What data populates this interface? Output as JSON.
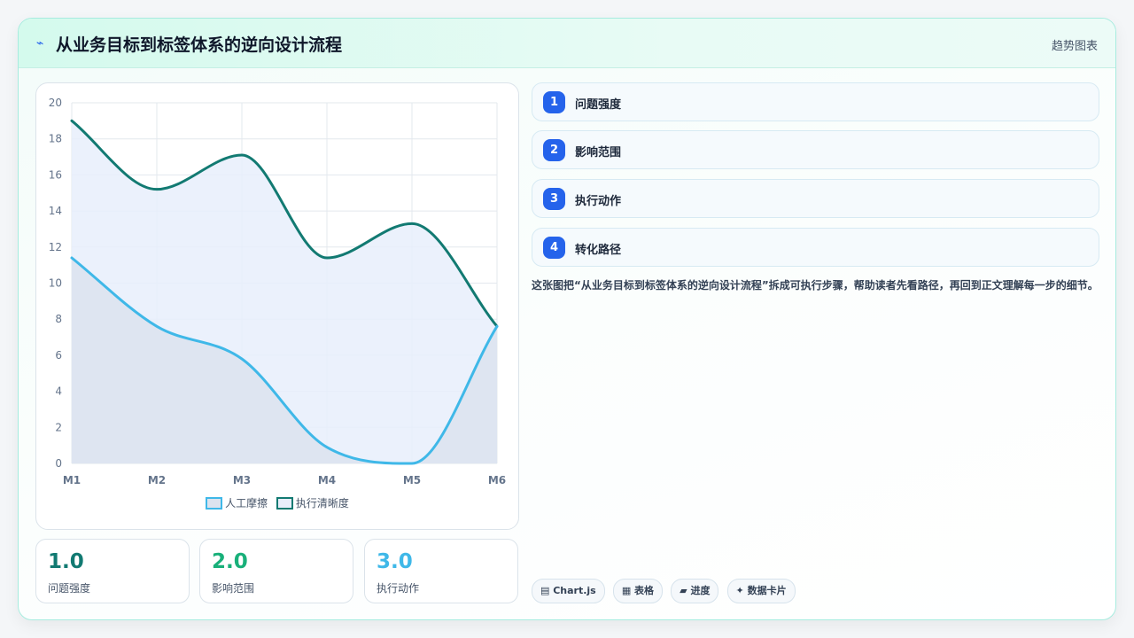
{
  "header": {
    "icon": "trend-bolt-icon",
    "title": "从业务目标到标签体系的逆向设计流程",
    "tag": "趋势图表"
  },
  "chart_data": {
    "type": "area",
    "x": [
      "M1",
      "M2",
      "M3",
      "M4",
      "M5",
      "M6"
    ],
    "ylim": [
      0,
      20
    ],
    "yticks": [
      "0",
      "2",
      "4",
      "6",
      "8",
      "10",
      "12",
      "14",
      "16",
      "18",
      "20"
    ],
    "grid": true,
    "legend_position": "bottom",
    "series": [
      {
        "name": "人工摩擦",
        "values": [
          11.4,
          7.6,
          5.8,
          0.9,
          0.0,
          7.6
        ],
        "color": "#3fb8e8",
        "fill": "#dce3ef"
      },
      {
        "name": "执行清晰度",
        "values": [
          19.0,
          15.2,
          17.1,
          11.4,
          13.3,
          7.6
        ],
        "color": "#127a72",
        "fill": "#e8eefb"
      }
    ]
  },
  "stats": [
    {
      "value": "1.0",
      "label": "问题强度",
      "color": "#127a72"
    },
    {
      "value": "2.0",
      "label": "影响范围",
      "color": "#19b07a"
    },
    {
      "value": "3.0",
      "label": "执行动作",
      "color": "#3fb8e8"
    }
  ],
  "steps": [
    {
      "num": "1",
      "label": "问题强度"
    },
    {
      "num": "2",
      "label": "影响范围"
    },
    {
      "num": "3",
      "label": "执行动作"
    },
    {
      "num": "4",
      "label": "转化路径"
    }
  ],
  "description": "这张图把“从业务目标到标签体系的逆向设计流程”拆成可执行步骤，帮助读者先看路径，再回到正文理解每一步的细节。",
  "chips": [
    {
      "icon": "chart-icon",
      "label": "▤ Chart.js"
    },
    {
      "icon": "table-icon",
      "label": "▦ 表格"
    },
    {
      "icon": "progress-icon",
      "label": "▰ 进度"
    },
    {
      "icon": "card-icon",
      "label": "✦ 数据卡片"
    }
  ]
}
